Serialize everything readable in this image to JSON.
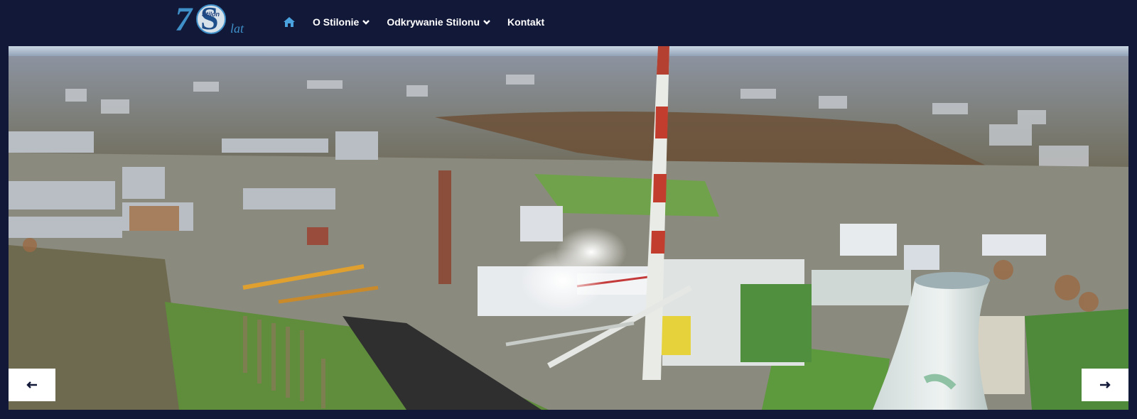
{
  "logo": {
    "number": "7",
    "letter": "S",
    "brand": "Stilon",
    "suffix": "lat"
  },
  "nav": {
    "home_icon": "home-icon",
    "items": [
      {
        "label": "O Stilonie",
        "icon": "chevron-down-icon"
      },
      {
        "label": "Odkrywanie Stilonu",
        "icon": "chevron-down-icon"
      },
      {
        "label": "Kontakt"
      }
    ]
  },
  "slider": {
    "prev_icon": "arrow-left-icon",
    "next_icon": "arrow-right-icon"
  },
  "colors": {
    "header_bg": "#121838",
    "accent": "#3f8fc8",
    "nav_text": "#ffffff"
  }
}
